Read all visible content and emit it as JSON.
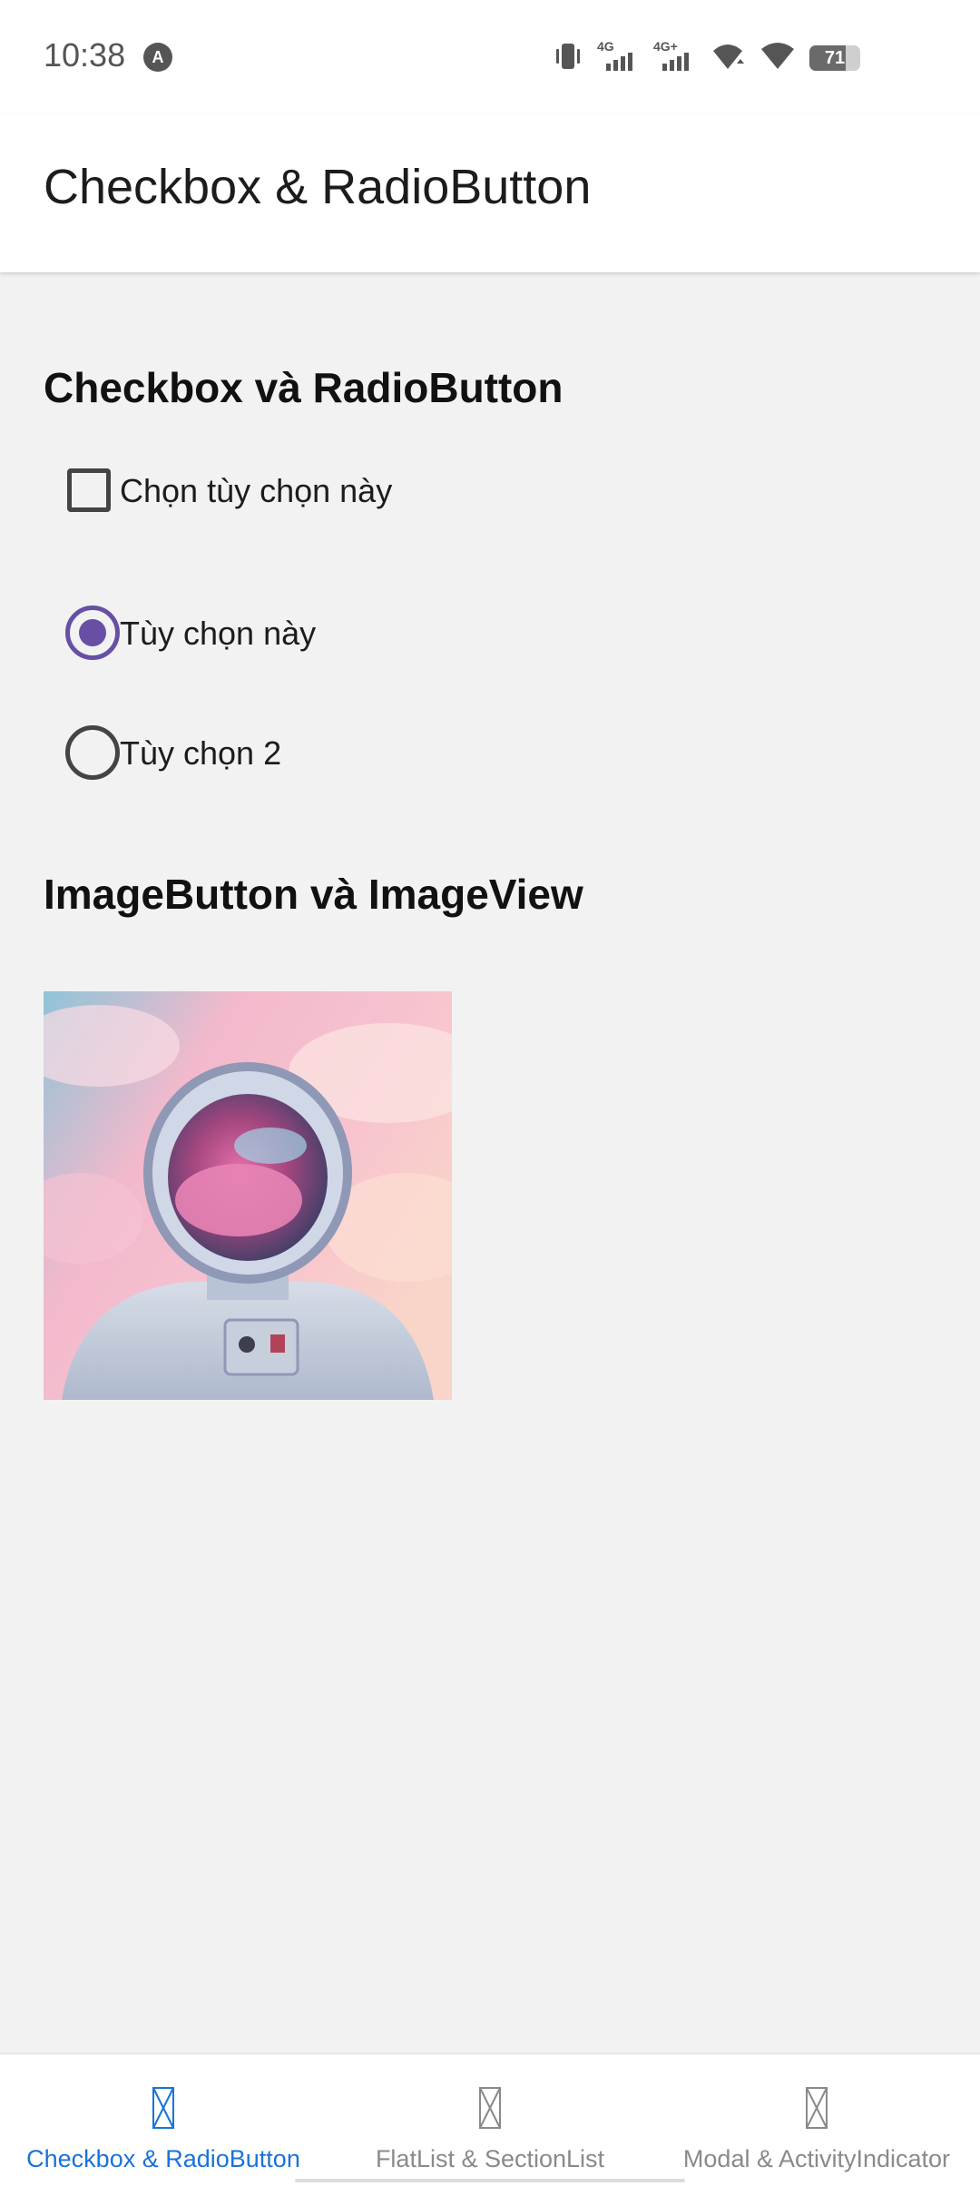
{
  "status_bar": {
    "time": "10:38",
    "app_indicator_glyph": "A",
    "network_1": "4G",
    "network_2": "4G+",
    "battery_level": 71,
    "battery_text": "71"
  },
  "header": {
    "title": "Checkbox & RadioButton"
  },
  "section_checkbox": {
    "title": "Checkbox và RadioButton",
    "checkbox": {
      "label": "Chọn tùy chọn này",
      "checked": false
    },
    "radios": [
      {
        "label": "Tùy chọn này",
        "selected": true
      },
      {
        "label": "Tùy chọn 2",
        "selected": false
      }
    ]
  },
  "section_image": {
    "title": "ImageButton và ImageView"
  },
  "tabs": [
    {
      "label": "Checkbox & RadioButton",
      "active": true,
      "icon": "tab-placeholder-icon"
    },
    {
      "label": "FlatList & SectionList",
      "active": false,
      "icon": "tab-placeholder-icon"
    },
    {
      "label": "Modal & ActivityIndicator",
      "active": false,
      "icon": "tab-placeholder-icon"
    }
  ],
  "colors": {
    "accent": "#6750a4",
    "tab_active": "#1a73d9",
    "tab_inactive": "#8a8a8a",
    "background": "#f2f2f2"
  }
}
